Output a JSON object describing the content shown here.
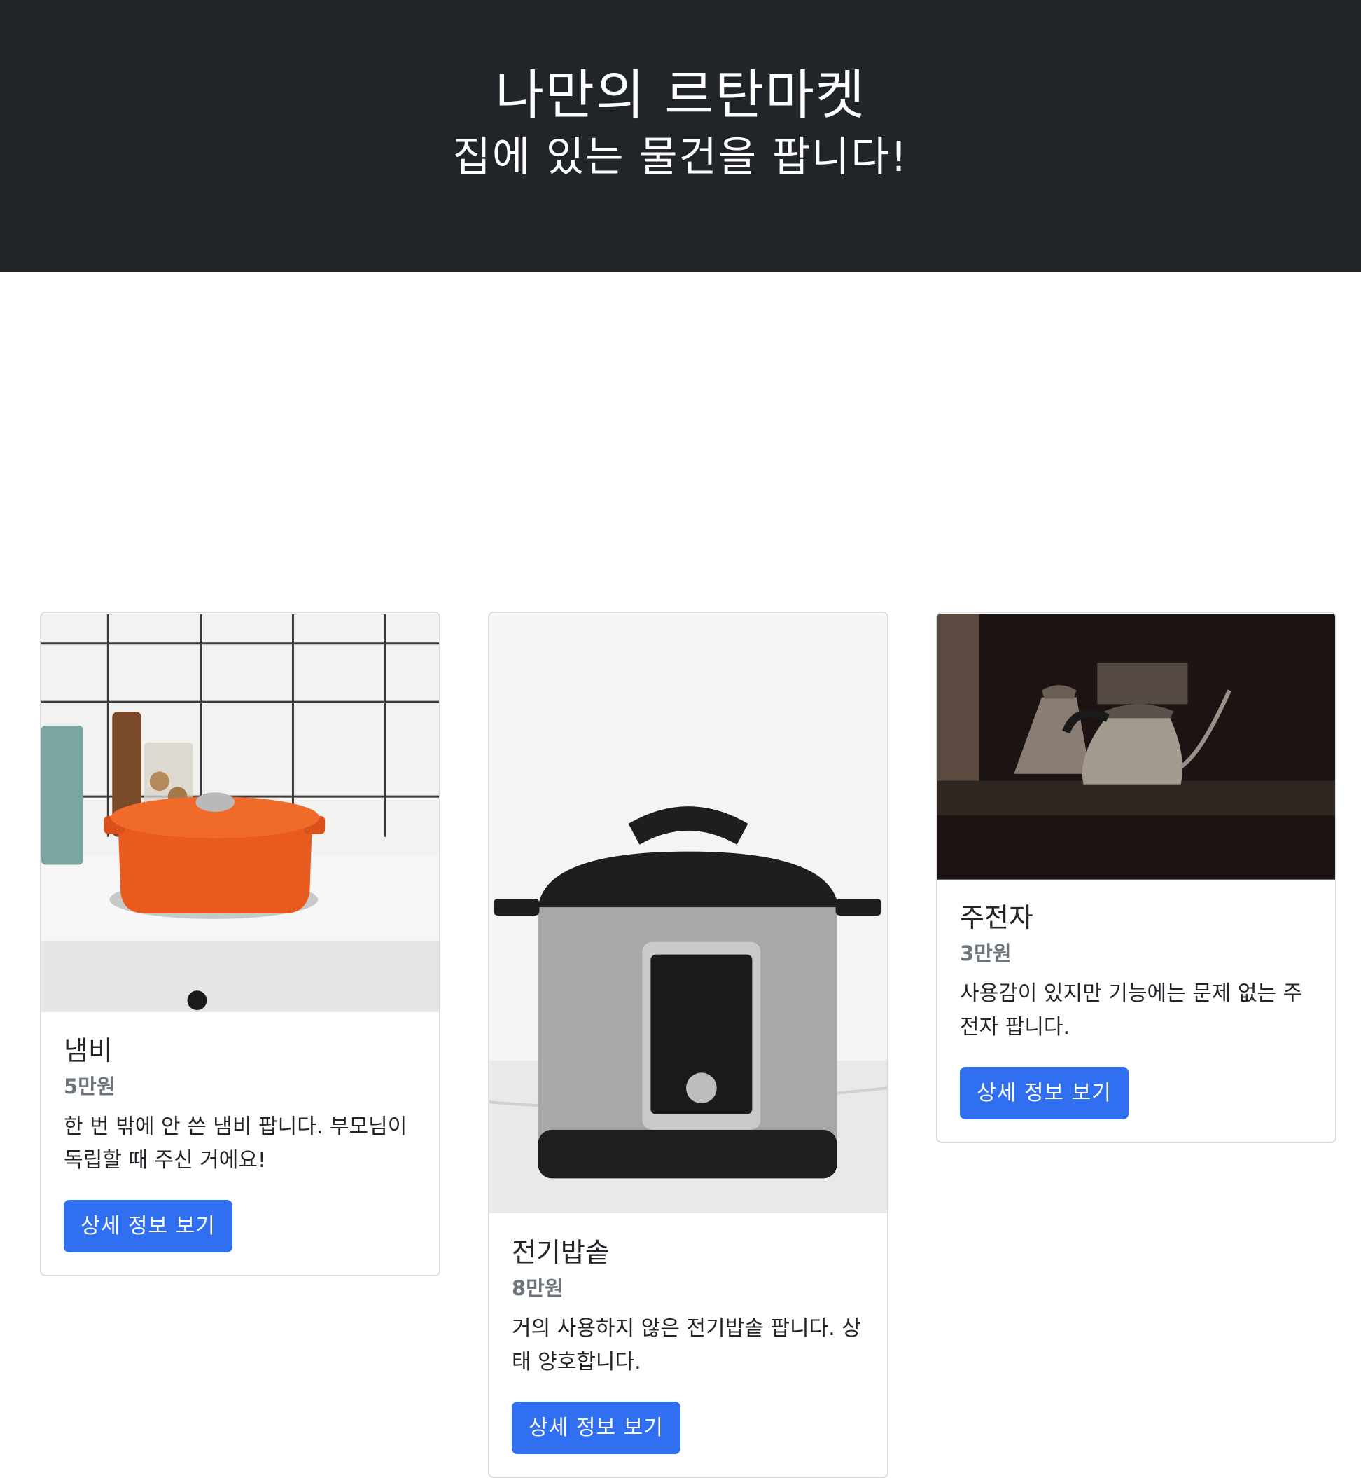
{
  "hero": {
    "title": "나만의 르탄마켓",
    "subtitle": "집에 있는 물건을 팝니다!"
  },
  "cards": [
    {
      "title": "냄비",
      "price": "5만원",
      "description": "한 번 밖에 안 쓴 냄비 팝니다. 부모님이 독립할 때 주신 거에요!",
      "button_label": "상세 정보 보기"
    },
    {
      "title": "전기밥솥",
      "price": "8만원",
      "description": "거의 사용하지 않은 전기밥솥 팝니다. 상태 양호합니다.",
      "button_label": "상세 정보 보기"
    },
    {
      "title": "주전자",
      "price": "3만원",
      "description": "사용감이 있지만 기능에는 문제 없는 주전자 팝니다.",
      "button_label": "상세 정보 보기"
    }
  ]
}
